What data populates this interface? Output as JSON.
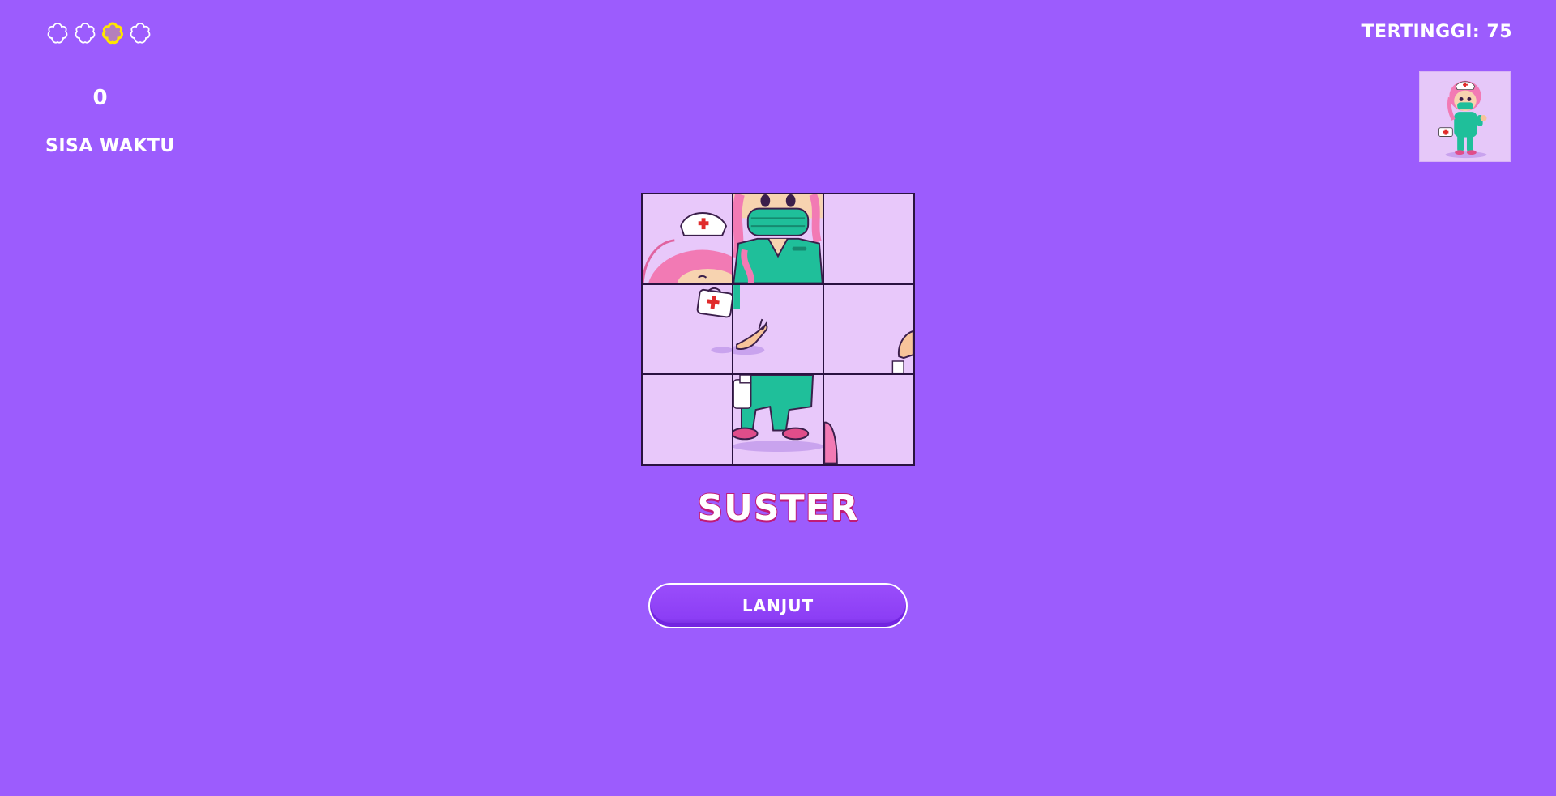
{
  "hud": {
    "lives": [
      {
        "icon": "flower-icon",
        "state": "empty"
      },
      {
        "icon": "flower-icon",
        "state": "empty"
      },
      {
        "icon": "flower-icon",
        "state": "active"
      },
      {
        "icon": "flower-icon",
        "state": "empty"
      }
    ],
    "score": "0",
    "time_label": "SISA WAKTU",
    "highscore": "TERTINGGI: 75"
  },
  "preview": {
    "icon": "nurse-character-preview"
  },
  "puzzle": {
    "grid": "3x3",
    "tiles": [
      {
        "row": 0,
        "col": 0,
        "icon": "nurse-cap-tile"
      },
      {
        "row": 0,
        "col": 1,
        "icon": "nurse-face-mask-tile"
      },
      {
        "row": 0,
        "col": 2,
        "icon": "empty-tile"
      },
      {
        "row": 1,
        "col": 0,
        "icon": "medical-kit-tile"
      },
      {
        "row": 1,
        "col": 1,
        "icon": "waving-hand-tile"
      },
      {
        "row": 1,
        "col": 2,
        "icon": "hand-edge-tile"
      },
      {
        "row": 2,
        "col": 0,
        "icon": "empty-tile"
      },
      {
        "row": 2,
        "col": 1,
        "icon": "nurse-legs-tile"
      },
      {
        "row": 2,
        "col": 2,
        "icon": "hair-edge-tile"
      }
    ]
  },
  "word": "SUSTER",
  "next_button": "LANJUT",
  "colors": {
    "background": "#9c5cfd",
    "tile_bg": "#e8c8fa",
    "accent_pink": "#c01b77",
    "scrubs": "#1fbf9a",
    "hair": "#f27ab4",
    "active_life": "#ffe600"
  }
}
